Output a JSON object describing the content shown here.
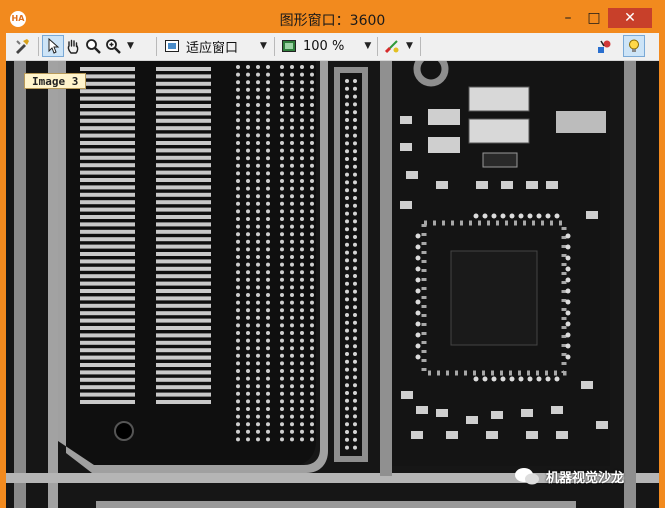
{
  "window": {
    "title": "图形窗口：3600",
    "app_icon_text": "HA",
    "minimize_glyph": "–",
    "maximize_glyph": "□",
    "close_glyph": "✕",
    "accent_color": "#f28a1e"
  },
  "toolbar": {
    "fit_mode": "适应窗口",
    "zoom_level": "100 %",
    "icons": [
      "tools-icon",
      "pointer-icon",
      "hand-pan-icon",
      "magnifier-icon",
      "zoom-in-icon",
      "fit-window-icon",
      "zoom-view-icon",
      "color-brush-icon",
      "graphics-stack-icon",
      "lightbulb-icon"
    ]
  },
  "viewport": {
    "image_label": "Image 3",
    "watermark": "机器视觉沙龙",
    "background_color": "#151515"
  }
}
